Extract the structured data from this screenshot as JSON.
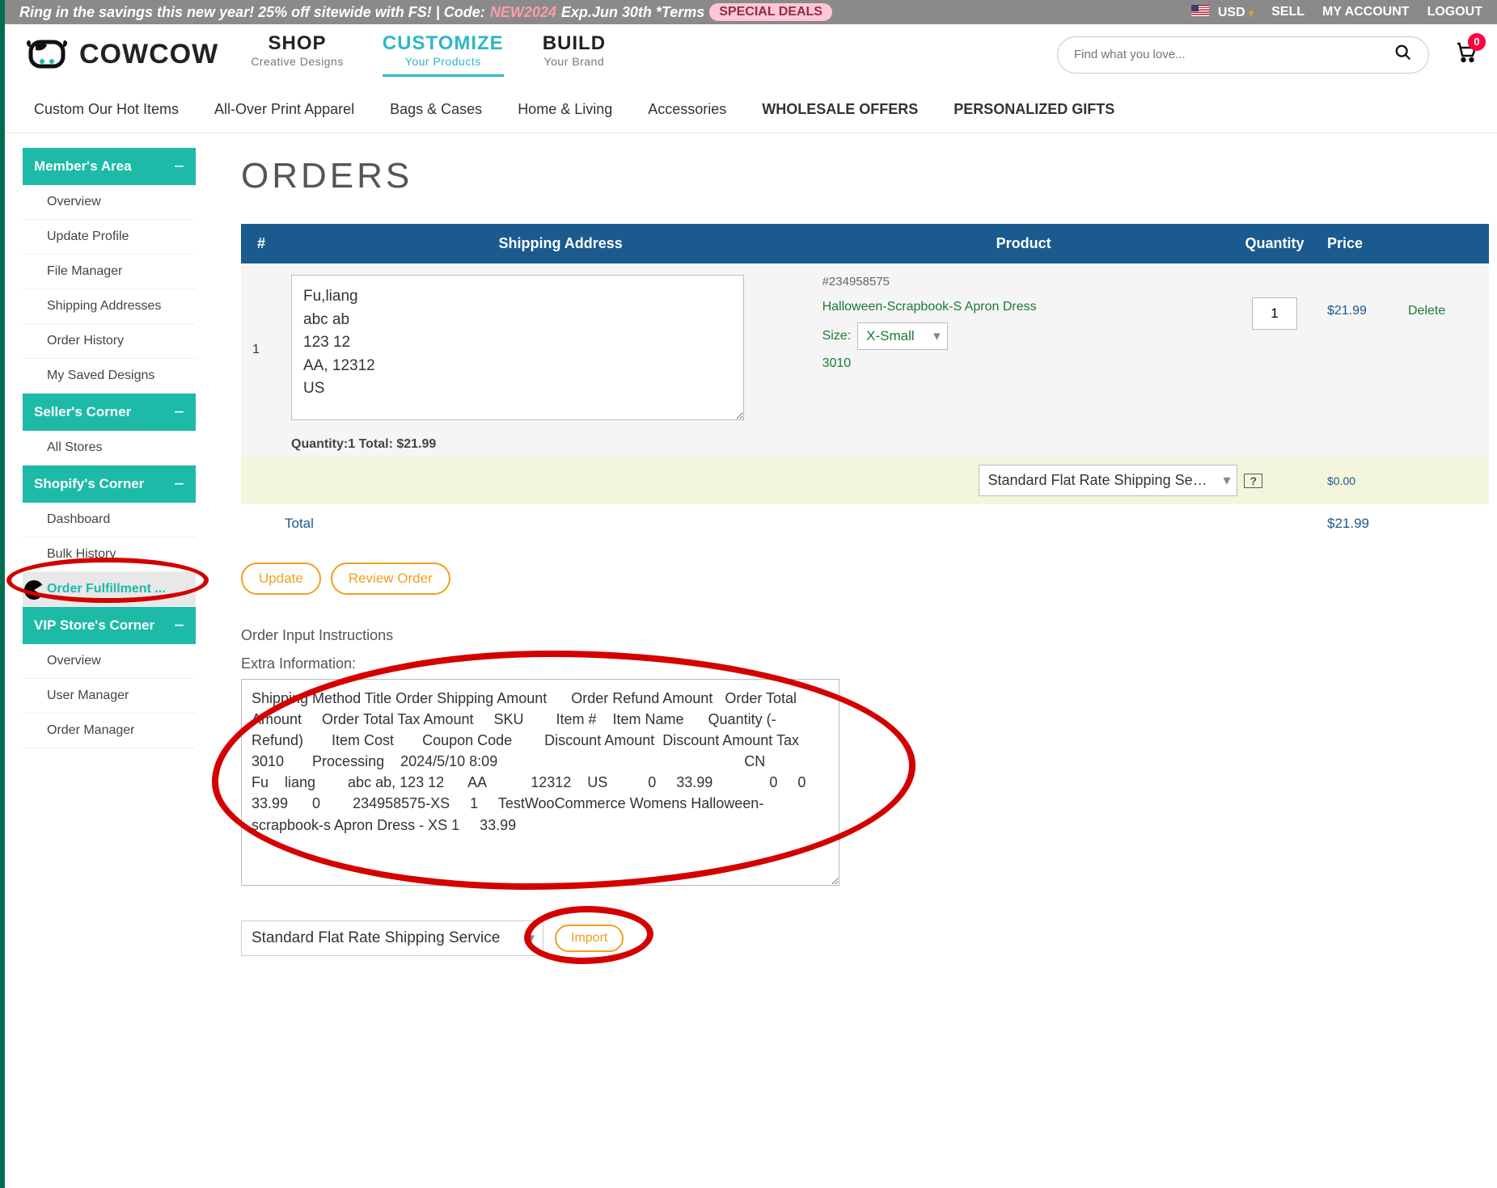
{
  "promo": {
    "text": "Ring in the savings this new year! 25% off sitewide with FS! | Code:",
    "code": "NEW2024",
    "exp": "Exp.Jun 30th *Terms",
    "special": "SPECIAL DEALS"
  },
  "top_right": {
    "currency": "USD",
    "sell": "SELL",
    "account": "MY ACCOUNT",
    "logout": "LOGOUT"
  },
  "logo": "COWCOW",
  "nav": {
    "shop": {
      "big": "SHOP",
      "small": "Creative Designs"
    },
    "customize": {
      "big": "CUSTOMIZE",
      "small": "Your Products"
    },
    "build": {
      "big": "BUILD",
      "small": "Your Brand"
    }
  },
  "search_placeholder": "Find what you love...",
  "cart_count": "0",
  "categories": [
    "Custom Our Hot Items",
    "All-Over Print Apparel",
    "Bags & Cases",
    "Home & Living",
    "Accessories",
    "WHOLESALE OFFERS",
    "PERSONALIZED GIFTS"
  ],
  "sidebar": {
    "members": {
      "title": "Member's Area",
      "items": [
        "Overview",
        "Update Profile",
        "File Manager",
        "Shipping Addresses",
        "Order History",
        "My Saved Designs"
      ]
    },
    "seller": {
      "title": "Seller's Corner",
      "items": [
        "All Stores"
      ]
    },
    "shopify": {
      "title": "Shopify's Corner",
      "items": [
        "Dashboard",
        "Bulk History",
        "Order Fulfillment ..."
      ]
    },
    "vip": {
      "title": "VIP Store's Corner",
      "items": [
        "Overview",
        "User Manager",
        "Order Manager"
      ]
    }
  },
  "page_title": "ORDERS",
  "table": {
    "headers": {
      "num": "#",
      "addr": "Shipping Address",
      "product": "Product",
      "qty": "Quantity",
      "price": "Price"
    },
    "row": {
      "num": "1",
      "address": "Fu,liang\nabc ab\n123 12\nAA, 12312\nUS",
      "summary": "Quantity:1 Total: $21.99",
      "product_id": "#234958575",
      "product_name": "Halloween-Scrapbook-S Apron Dress",
      "size_label": "Size:",
      "size_value": "X-Small",
      "sku": "3010",
      "qty": "1",
      "price": "$21.99",
      "delete": "Delete"
    },
    "ship_option": "Standard Flat Rate Shipping Service",
    "ship_help": "?",
    "ship_price": "$0.00",
    "total_label": "Total",
    "total_value": "$21.99"
  },
  "buttons": {
    "update": "Update",
    "review": "Review Order",
    "import": "Import"
  },
  "instructions_label": "Order Input Instructions",
  "extra_label": "Extra Information:",
  "extra_text": "Shipping Method Title Order Shipping Amount      Order Refund Amount   Order Total Amount     Order Total Tax Amount     SKU        Item #    Item Name      Quantity (- Refund)       Item Cost       Coupon Code        Discount Amount  Discount Amount Tax\n3010       Processing    2024/5/10 8:09                                                             CN                 Fu    liang        abc ab, 123 12      AA           12312    US          0     33.99              0     0       33.99      0        234958575-XS     1     TestWooCommerce Womens Halloween-scrapbook-s Apron Dress - XS 1     33.99",
  "import_select": "Standard Flat Rate Shipping Service"
}
